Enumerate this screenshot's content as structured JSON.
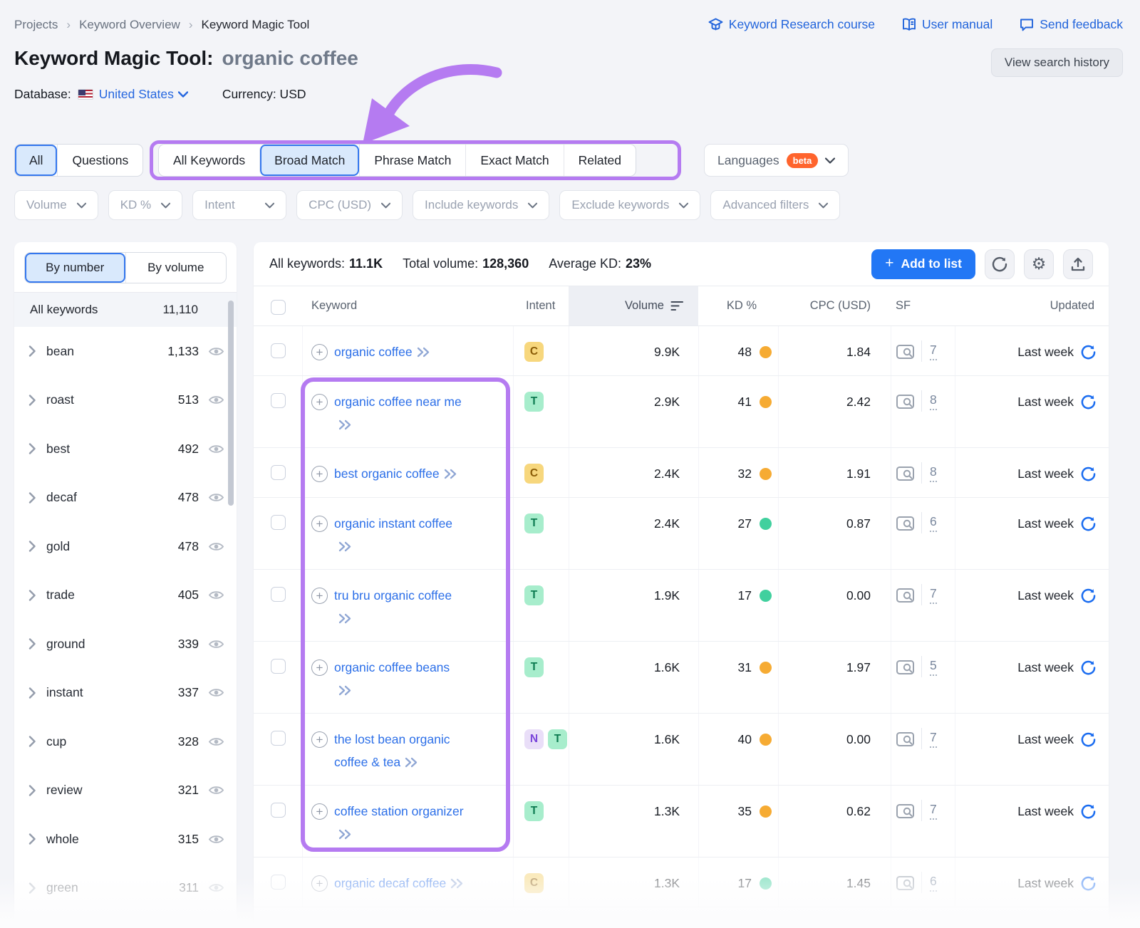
{
  "breadcrumb": [
    "Projects",
    "Keyword Overview",
    "Keyword Magic Tool"
  ],
  "header_links": [
    {
      "icon": "course-icon",
      "label": "Keyword Research course"
    },
    {
      "icon": "manual-icon",
      "label": "User manual"
    },
    {
      "icon": "feedback-icon",
      "label": "Send feedback"
    }
  ],
  "title": {
    "main": "Keyword Magic Tool:",
    "query": "organic coffee"
  },
  "meta": {
    "database_label": "Database:",
    "database_value": "United States",
    "currency": "Currency: USD"
  },
  "history_button": "View search history",
  "question_tabs": [
    {
      "label": "All",
      "active": true
    },
    {
      "label": "Questions",
      "active": false
    }
  ],
  "match_tabs": [
    {
      "label": "All Keywords",
      "active": false
    },
    {
      "label": "Broad Match",
      "active": true
    },
    {
      "label": "Phrase Match",
      "active": false
    },
    {
      "label": "Exact Match",
      "active": false
    },
    {
      "label": "Related",
      "active": false
    }
  ],
  "languages": {
    "label": "Languages",
    "badge": "beta"
  },
  "filters": [
    "Volume",
    "KD %",
    "Intent",
    "CPC (USD)",
    "Include keywords",
    "Exclude keywords",
    "Advanced filters"
  ],
  "sidebar": {
    "sort_tabs": [
      {
        "label": "By number",
        "active": true
      },
      {
        "label": "By volume",
        "active": false
      }
    ],
    "all_row": {
      "label": "All keywords",
      "count": "11,110"
    },
    "groups": [
      {
        "label": "bean",
        "count": "1,133"
      },
      {
        "label": "roast",
        "count": "513"
      },
      {
        "label": "best",
        "count": "492"
      },
      {
        "label": "decaf",
        "count": "478"
      },
      {
        "label": "gold",
        "count": "478"
      },
      {
        "label": "trade",
        "count": "405"
      },
      {
        "label": "ground",
        "count": "339"
      },
      {
        "label": "instant",
        "count": "337"
      },
      {
        "label": "cup",
        "count": "328"
      },
      {
        "label": "review",
        "count": "321"
      },
      {
        "label": "whole",
        "count": "315"
      },
      {
        "label": "green",
        "count": "311",
        "faded": true
      }
    ]
  },
  "stats": [
    {
      "label": "All keywords:",
      "value": "11.1K"
    },
    {
      "label": "Total volume:",
      "value": "128,360"
    },
    {
      "label": "Average KD:",
      "value": "23%"
    }
  ],
  "add_to_list": "Add to list",
  "table": {
    "headers": [
      "Keyword",
      "Intent",
      "Volume",
      "KD %",
      "CPC (USD)",
      "SF",
      "Updated"
    ],
    "rows": [
      {
        "keyword": "organic coffee",
        "intents": [
          "C"
        ],
        "volume": "9.9K",
        "kd": "48",
        "kd_level": "orange",
        "cpc": "1.84",
        "sf": "7",
        "updated": "Last week",
        "faded": false
      },
      {
        "keyword": "organic coffee near me",
        "intents": [
          "T"
        ],
        "volume": "2.9K",
        "kd": "41",
        "kd_level": "orange",
        "cpc": "2.42",
        "sf": "8",
        "updated": "Last week",
        "faded": false
      },
      {
        "keyword": "best organic coffee",
        "intents": [
          "C"
        ],
        "volume": "2.4K",
        "kd": "32",
        "kd_level": "orange",
        "cpc": "1.91",
        "sf": "8",
        "updated": "Last week",
        "faded": false
      },
      {
        "keyword": "organic instant coffee",
        "intents": [
          "T"
        ],
        "volume": "2.4K",
        "kd": "27",
        "kd_level": "green",
        "cpc": "0.87",
        "sf": "6",
        "updated": "Last week",
        "faded": false
      },
      {
        "keyword": "tru bru organic coffee",
        "intents": [
          "T"
        ],
        "volume": "1.9K",
        "kd": "17",
        "kd_level": "green",
        "cpc": "0.00",
        "sf": "7",
        "updated": "Last week",
        "faded": false
      },
      {
        "keyword": "organic coffee beans",
        "intents": [
          "T"
        ],
        "volume": "1.6K",
        "kd": "31",
        "kd_level": "orange",
        "cpc": "1.97",
        "sf": "5",
        "updated": "Last week",
        "faded": false
      },
      {
        "keyword": "the lost bean organic coffee & tea",
        "intents": [
          "N",
          "T"
        ],
        "volume": "1.6K",
        "kd": "40",
        "kd_level": "orange",
        "cpc": "0.00",
        "sf": "7",
        "updated": "Last week",
        "faded": false
      },
      {
        "keyword": "coffee station organizer",
        "intents": [
          "T"
        ],
        "volume": "1.3K",
        "kd": "35",
        "kd_level": "orange",
        "cpc": "0.62",
        "sf": "7",
        "updated": "Last week",
        "faded": false
      },
      {
        "keyword": "organic decaf coffee",
        "intents": [
          "C"
        ],
        "volume": "1.3K",
        "kd": "17",
        "kd_level": "green",
        "cpc": "1.45",
        "sf": "6",
        "updated": "Last week",
        "faded": true
      }
    ]
  },
  "colors": {
    "annotation": "#b57bf1",
    "kd_levels": {
      "orange": "#f6ab33",
      "green": "#41d09e"
    },
    "intent_badges": {
      "C": {
        "bg": "#f7d77d",
        "fg": "#8a5c07"
      },
      "T": {
        "bg": "#a7edcc",
        "fg": "#0c7a50"
      },
      "N": {
        "bg": "#e9def8",
        "fg": "#7a45da"
      }
    },
    "accent_blue": "#2277f5"
  }
}
